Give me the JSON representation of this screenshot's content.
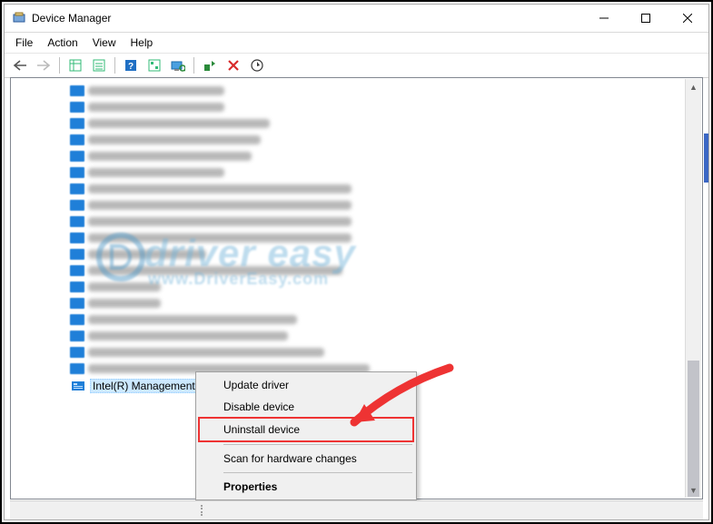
{
  "window": {
    "title": "Device Manager"
  },
  "menubar": {
    "file": "File",
    "action": "Action",
    "view": "View",
    "help": "Help"
  },
  "selected_device": {
    "label": "Intel(R) Management E"
  },
  "context_menu": {
    "update": "Update driver",
    "disable": "Disable device",
    "uninstall": "Uninstall device",
    "scan": "Scan for hardware changes",
    "properties": "Properties"
  },
  "watermark": {
    "line1": "driver easy",
    "line2": "www.DriverEasy.com"
  },
  "blur_rows": [
    150,
    150,
    200,
    190,
    180,
    150,
    290,
    290,
    290,
    290,
    130,
    280,
    80,
    80,
    230,
    220,
    260,
    310
  ]
}
